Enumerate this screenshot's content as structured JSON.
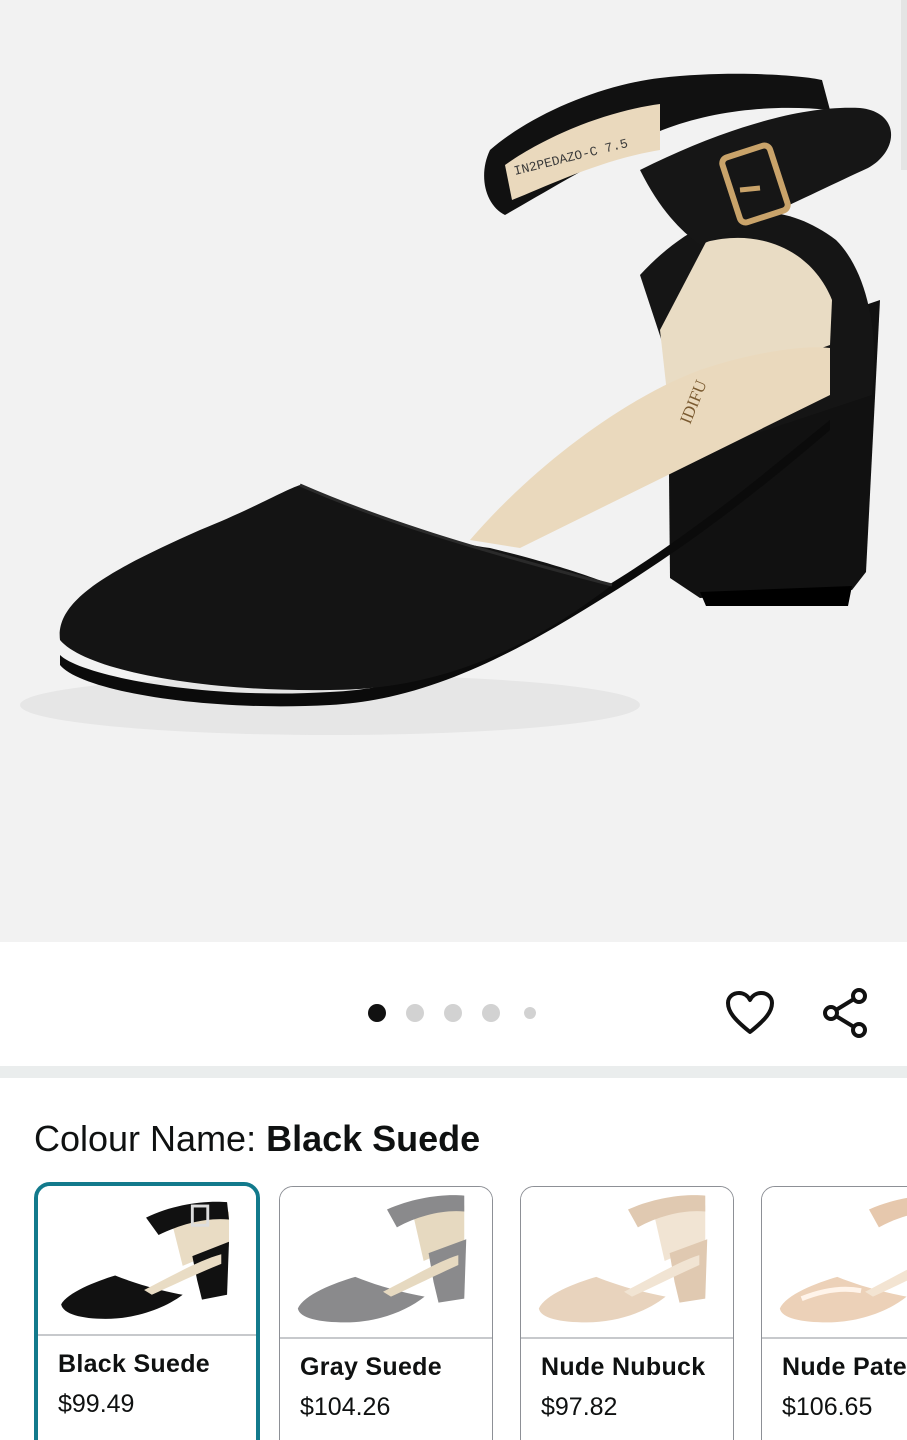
{
  "product_image": {
    "insole_marking": "IN2PEDAZO-C 7.5",
    "brand_logo": "IDIFU"
  },
  "carousel": {
    "total": 5,
    "active_index": 0
  },
  "actions": {
    "wishlist_icon": "heart-icon",
    "share_icon": "share-icon"
  },
  "colour": {
    "label": "Colour Name: ",
    "selected": "Black Suede"
  },
  "swatches": [
    {
      "name": "Black Suede",
      "price": "$99.49",
      "color": "#111111",
      "lining": "#e9dcc4",
      "selected": true
    },
    {
      "name": "Gray Suede",
      "price": "$104.26",
      "color": "#8a8a8c",
      "lining": "#e6d9c0",
      "selected": false
    },
    {
      "name": "Nude Nubuck",
      "price": "$97.82",
      "color": "#e8d3bd",
      "lining": "#f1e4d3",
      "selected": false
    },
    {
      "name": "Nude Patent",
      "price": "$106.65",
      "color": "#ecd1b8",
      "lining": "#f3e4d2",
      "selected": false
    }
  ],
  "colors": {
    "selected_border": "#127a8c",
    "background_hero": "#f2f2f2"
  }
}
